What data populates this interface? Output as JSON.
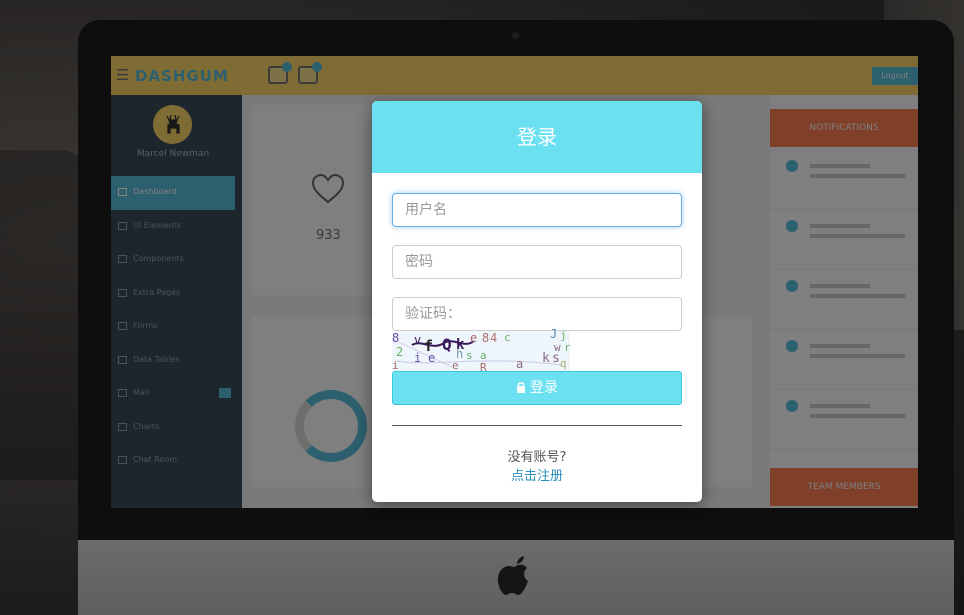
{
  "dashboard": {
    "brand": "DASHGUM",
    "user_name": "Marcel Newman",
    "top_button": "Logout",
    "nav_items": [
      "Dashboard",
      "UI Elements",
      "Components",
      "Extra Pages",
      "Forms",
      "Data Tables",
      "Mail",
      "Charts",
      "Chat Room"
    ],
    "stat_value": "933",
    "right_panel": {
      "notifications_title": "NOTIFICATIONS",
      "team_title": "TEAM MEMBERS"
    }
  },
  "login": {
    "title": "登录",
    "username_placeholder": "用户名",
    "password_placeholder": "密码",
    "captcha_placeholder": "验证码：",
    "captcha_chars": "8vfQkJe84cJjwr2ihsaksqieRa",
    "submit_label": "登录",
    "no_account_text": "没有账号?",
    "register_link": "点击注册"
  },
  "colors": {
    "accent": "#6ae0f0",
    "link": "#2a8fbd",
    "topbar": "#ffd86b",
    "sidebar": "#3b4a5a",
    "notifications": "#ff7f50"
  }
}
